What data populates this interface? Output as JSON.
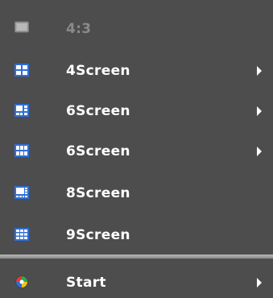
{
  "menu": {
    "items": [
      {
        "label": "4:3",
        "icon": "monitor-icon",
        "submenu": false,
        "disabled": true
      },
      {
        "label": "4Screen",
        "icon": "grid-4-icon",
        "submenu": true,
        "disabled": false
      },
      {
        "label": "6Screen",
        "icon": "grid-6a-icon",
        "submenu": true,
        "disabled": false
      },
      {
        "label": "6Screen",
        "icon": "grid-6b-icon",
        "submenu": true,
        "disabled": false
      },
      {
        "label": "8Screen",
        "icon": "grid-8-icon",
        "submenu": false,
        "disabled": false
      },
      {
        "label": "9Screen",
        "icon": "grid-9-icon",
        "submenu": false,
        "disabled": false
      }
    ],
    "start": {
      "label": "Start",
      "icon": "start-icon",
      "submenu": true
    }
  },
  "colors": {
    "background": "#4d4d4d",
    "text": "#ffffff",
    "disabled_text": "#8a8a8a",
    "icon_blue": "#2f6fd6"
  }
}
